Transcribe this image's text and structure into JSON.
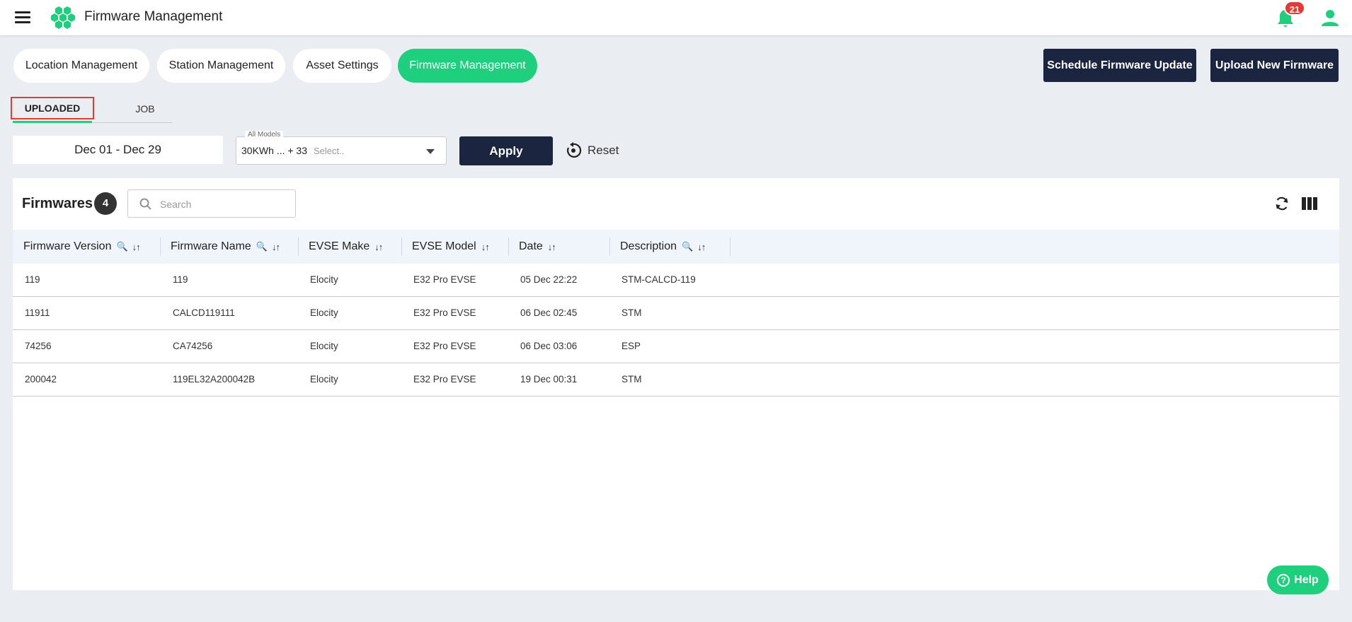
{
  "header": {
    "app_title": "Firmware Management",
    "notification_count": "21",
    "brand_color": "#1ecf7e",
    "icons": [
      "menu-icon",
      "hexagon-logo-icon",
      "bell-icon",
      "user-icon"
    ]
  },
  "top_tabs": [
    {
      "label": "Location Management",
      "active": false
    },
    {
      "label": "Station Management",
      "active": false
    },
    {
      "label": "Asset Settings",
      "active": false
    },
    {
      "label": "Firmware Management",
      "active": true
    }
  ],
  "actions": {
    "schedule_label": "Schedule Firmware Update",
    "upload_label": "Upload New Firmware"
  },
  "sub_tabs": [
    {
      "label": "UPLOADED",
      "active": true
    },
    {
      "label": "JOB",
      "active": false
    }
  ],
  "filters": {
    "date_range": "Dec 01 - Dec 29",
    "models_legend": "All Models",
    "models_value": "30KWh ... + 33",
    "models_placeholder": "Select..",
    "apply_label": "Apply",
    "reset_label": "Reset"
  },
  "table": {
    "title": "Firmwares",
    "count": "4",
    "search_placeholder": "Search",
    "columns": [
      "Firmware Version",
      "Firmware Name",
      "EVSE Make",
      "EVSE Model",
      "Date",
      "Description"
    ],
    "rows": [
      [
        "119",
        "119",
        "Elocity",
        "E32 Pro EVSE",
        "05 Dec 22:22",
        "STM-CALCD-119"
      ],
      [
        "11911",
        "CALCD119111",
        "Elocity",
        "E32 Pro EVSE",
        "06 Dec 02:45",
        "STM"
      ],
      [
        "74256",
        "CA74256",
        "Elocity",
        "E32 Pro EVSE",
        "06 Dec 03:06",
        "ESP"
      ],
      [
        "200042",
        "119EL32A200042B",
        "Elocity",
        "E32 Pro EVSE",
        "19 Dec 00:31",
        "STM"
      ]
    ]
  },
  "help": {
    "label": "Help"
  }
}
